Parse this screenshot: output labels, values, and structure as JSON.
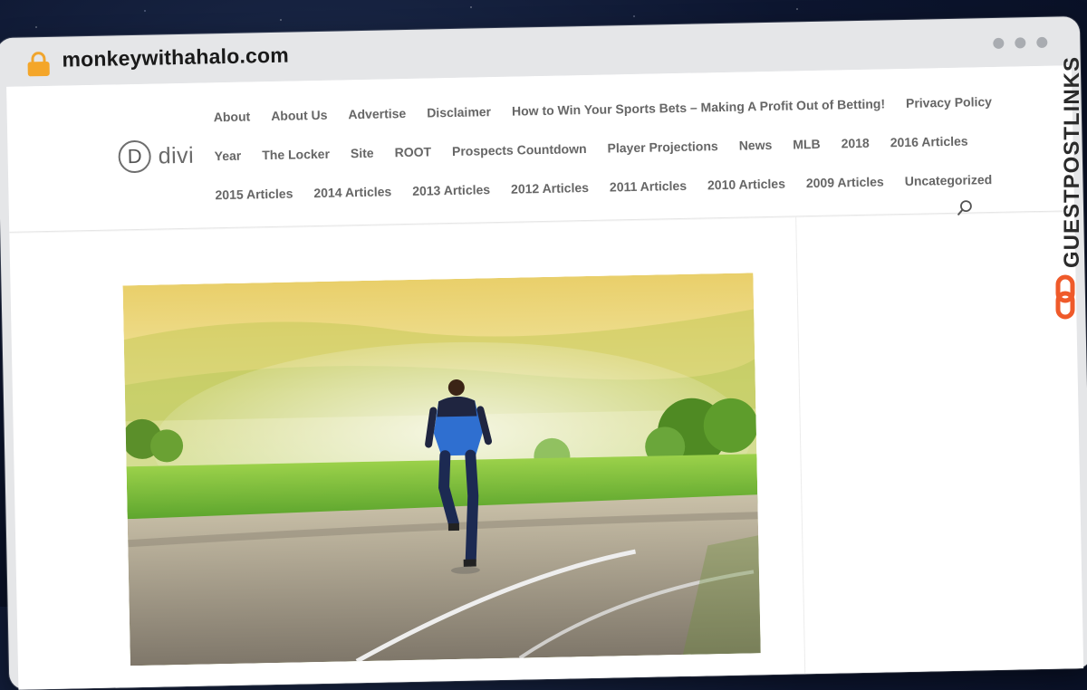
{
  "browser": {
    "url": "monkeywithahalo.com"
  },
  "site": {
    "logo_letter": "D",
    "logo_text": "divi"
  },
  "nav": {
    "rows": [
      [
        "About",
        "About Us",
        "Advertise",
        "Disclaimer",
        "How to Win Your Sports Bets – Making A Profit Out of Betting!",
        "Privacy Policy"
      ],
      [
        "Year",
        "The Locker",
        "Site",
        "ROOT",
        "Prospects Countdown",
        "Player Projections",
        "News",
        "MLB",
        "2018",
        "2016 Articles"
      ],
      [
        "2015 Articles",
        "2014 Articles",
        "2013 Articles",
        "2012 Articles",
        "2011 Articles",
        "2010 Articles",
        "2009 Articles",
        "Uncategorized"
      ]
    ]
  },
  "watermark": {
    "text": "GUESTPOSTLINKS"
  },
  "colors": {
    "accent_lock": "#f4a62a",
    "watermark_dark": "#2b2b2b",
    "watermark_orange": "#ef5a2a"
  }
}
